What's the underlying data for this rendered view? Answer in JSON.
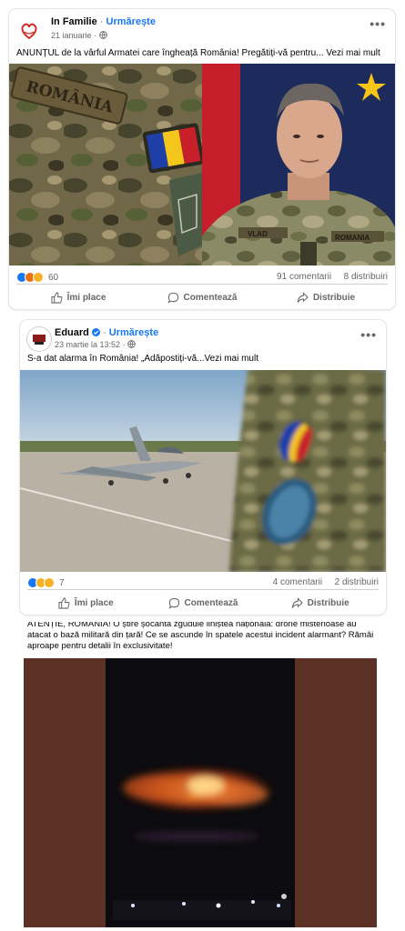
{
  "posts": [
    {
      "page_name": "In Familie",
      "follow_label": "Urmărește",
      "date": "21 ianuarie",
      "text": "ANUNȚUL de la vârful Armatei care îngheață România! Pregătiți-vă pentru... Vezi mai mult",
      "image_texts": {
        "patch": "ROMÂNIA",
        "name_tag": "VLAD",
        "rank_tag": "ROMANIA"
      },
      "reactions": [
        "like",
        "angry",
        "haha"
      ],
      "reaction_count": "60",
      "comments": "91 comentarii",
      "shares": "8 distribuiri",
      "actions": {
        "like": "Îmi place",
        "comment": "Comentează",
        "share": "Distribuie"
      }
    },
    {
      "page_name": "Eduard",
      "follow_label": "Urmărește",
      "date": "23 martie la 13:52",
      "text": "S-a dat alarma în România! „Adăpostiți-vă...Vezi mai mult",
      "reactions": [
        "like",
        "wow",
        "haha"
      ],
      "reaction_count": "7",
      "comments": "4 comentarii",
      "shares": "2 distribuiri",
      "actions": {
        "like": "Îmi place",
        "comment": "Comentează",
        "share": "Distribuie"
      }
    },
    {
      "text": "ATENȚIE, ROMÂNIA! O știre șocantă zguduie liniștea națională: drone misterioase au atacat o bază militară din țară! Ce se ascunde în spatele acestui incident alarmant? Rămâi aproape pentru detalii în exclusivitate!"
    }
  ],
  "colors": {
    "accent": "#1877f2",
    "secondary_text": "#65676b",
    "divider": "#ced0d4"
  }
}
